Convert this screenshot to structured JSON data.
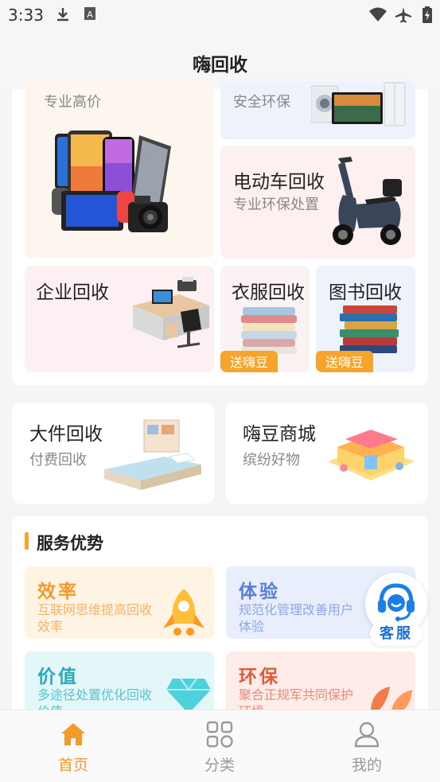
{
  "status_bar": {
    "time": "3:33",
    "icons": [
      "download-icon",
      "font-notification-icon",
      "wifi-icon",
      "airplane-mode-icon",
      "battery-charging-icon"
    ]
  },
  "header": {
    "title": "嗨回收"
  },
  "recycle_grid": {
    "digital": {
      "subtitle": "专业高价"
    },
    "appliance": {
      "subtitle": "安全环保"
    },
    "ebike": {
      "title": "电动车回收",
      "subtitle": "专业环保处置"
    },
    "enterprise": {
      "title": "企业回收"
    },
    "clothes": {
      "title": "衣服回收",
      "tag": "送嗨豆"
    },
    "books": {
      "title": "图书回收",
      "tag": "送嗨豆"
    }
  },
  "promo": {
    "large": {
      "title": "大件回收",
      "subtitle": "付费回收"
    },
    "mall": {
      "title": "嗨豆商城",
      "subtitle": "缤纷好物"
    }
  },
  "advantages": {
    "heading": "服务优势",
    "items": [
      {
        "title": "效率",
        "desc": "互联网思维提高回收效率",
        "color": "#f49a2c",
        "bg": "#fff4e4"
      },
      {
        "title": "体验",
        "desc": "规范化管理改善用户体验",
        "color": "#5a7ed6",
        "bg": "#e8eefc"
      },
      {
        "title": "价值",
        "desc": "多途径处置优化回收价值",
        "color": "#2aa9b8",
        "bg": "#e3f6f8"
      },
      {
        "title": "环保",
        "desc": "聚合正规军共同保护环境",
        "color": "#e25a3c",
        "bg": "#fdece8"
      }
    ]
  },
  "customer_service": {
    "label": "客服"
  },
  "tabbar": {
    "active_color": "#f49a2c",
    "inactive_color": "#999999",
    "items": [
      {
        "label": "首页",
        "icon": "home-icon",
        "active": true
      },
      {
        "label": "分类",
        "icon": "category-grid-icon",
        "active": false
      },
      {
        "label": "我的",
        "icon": "user-icon",
        "active": false
      }
    ]
  }
}
